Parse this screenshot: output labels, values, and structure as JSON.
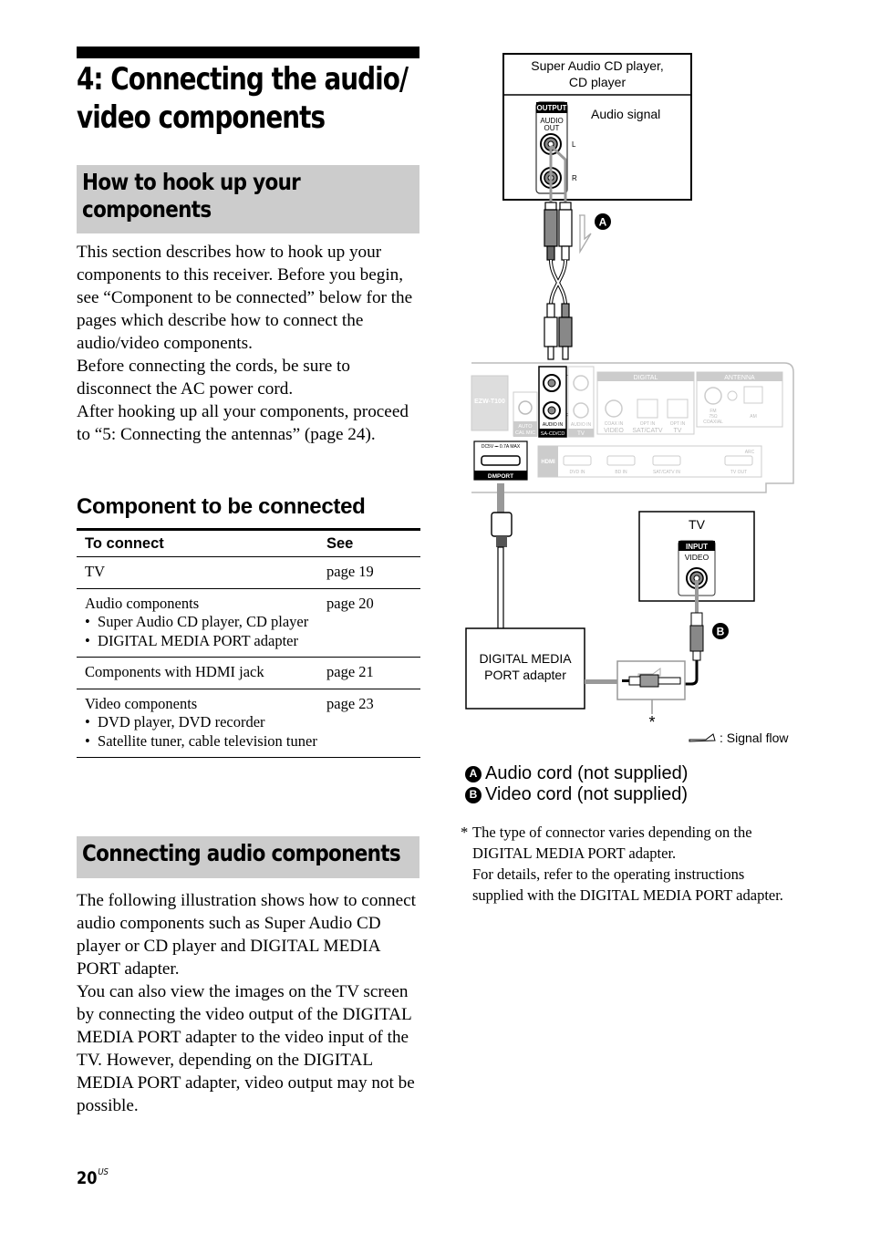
{
  "chapter": {
    "title_line1": "4: Connecting the audio/",
    "title_line2": "video components"
  },
  "section1": {
    "heading_line1": "How to hook up your",
    "heading_line2": "components",
    "paragraphs": [
      "This section describes how to hook up your components to this receiver. Before you begin, see “Component to be connected” below for the pages which describe how to connect the audio/video components.",
      "Before connecting the cords, be sure to disconnect the AC power cord.",
      "After hooking up all your components, proceed to “5: Connecting the antennas” (page 24)."
    ]
  },
  "component_table": {
    "heading": "Component to be connected",
    "columns": [
      "To connect",
      "See"
    ],
    "rows": [
      {
        "item": "TV",
        "bullets": [],
        "see": "page 19"
      },
      {
        "item": "Audio components",
        "bullets": [
          "Super Audio CD player, CD player",
          "DIGITAL MEDIA PORT adapter"
        ],
        "see": "page 20"
      },
      {
        "item": "Components with HDMI jack",
        "bullets": [],
        "see": "page 21"
      },
      {
        "item": "Video components",
        "bullets": [
          "DVD player, DVD recorder",
          "Satellite tuner, cable television tuner"
        ],
        "see": "page 23"
      }
    ]
  },
  "section2": {
    "heading": "Connecting audio components",
    "paragraphs": [
      "The following illustration shows how to connect audio components such as Super Audio CD player or CD player and DIGITAL MEDIA PORT adapter.",
      "You can also view the images on the TV screen by connecting the video output of the DIGITAL MEDIA PORT adapter to the video input of the TV. However, depending on the DIGITAL MEDIA PORT adapter, video output may not be possible."
    ]
  },
  "diagram": {
    "cd_player_label_line1": "Super Audio CD player,",
    "cd_player_label_line2": "CD player",
    "output_badge": "OUTPUT",
    "audio_out_line1": "AUDIO",
    "audio_out_line2": "OUT",
    "left": "L",
    "right": "R",
    "audio_signal": "Audio signal",
    "marker_a": "A",
    "marker_b": "B",
    "receiver_model": "EZW-T100",
    "auto_cal_line1": "AUTO",
    "auto_cal_line2": "CAL MIC",
    "audio_in": "AUDIO IN",
    "sa_cd": "SA-CD/CD",
    "tv_label": "TV",
    "digital": "DIGITAL",
    "antenna": "ANTENNA",
    "coax_in": "COAX IN",
    "video": "VIDEO",
    "opt_in": "OPT IN",
    "sat_catv": "SAT/CATV",
    "fm_line1": "FM",
    "fm_line2": "75Ω",
    "fm_line3": "COAXIAL",
    "am": "AM",
    "dmport_power": "DC5V ⎓ 0.7A MAX",
    "dmport": "DMPORT",
    "hdmi": "HDMI",
    "dvd_in": "DVD IN",
    "bd_in": "BD IN",
    "sat_catv_in": "SAT/CATV IN",
    "tv_out": "TV OUT",
    "arc": "ARC",
    "tv_box_label": "TV",
    "input_badge": "INPUT",
    "tv_video": "VIDEO",
    "adapter_line1": "DIGITAL MEDIA",
    "adapter_line2": "PORT adapter",
    "asterisk": "*",
    "signal_flow": ": Signal flow"
  },
  "legend": {
    "a_marker": "A",
    "a_label": "Audio cord (not supplied)",
    "b_marker": "B",
    "b_label": "Video cord (not supplied)"
  },
  "footnote": {
    "mark": "*",
    "lines": [
      "The type of connector varies depending on the DIGITAL MEDIA PORT adapter.",
      "For details, refer to the operating instructions supplied with the DIGITAL MEDIA PORT adapter."
    ]
  },
  "page": {
    "number": "20",
    "region": "US"
  }
}
